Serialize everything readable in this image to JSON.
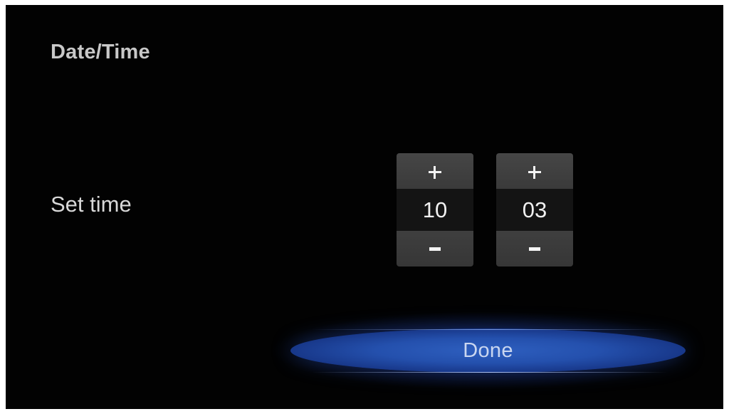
{
  "header": {
    "title": "Date/Time"
  },
  "time_setting": {
    "label": "Set time",
    "hours": {
      "increment_label": "+",
      "value": "10",
      "decrement_label": "−"
    },
    "minutes": {
      "increment_label": "+",
      "value": "03",
      "decrement_label": "−"
    }
  },
  "actions": {
    "done_label": "Done"
  },
  "colors": {
    "background": "#020202",
    "accent": "#2450ad",
    "text": "#d8d8d8"
  }
}
